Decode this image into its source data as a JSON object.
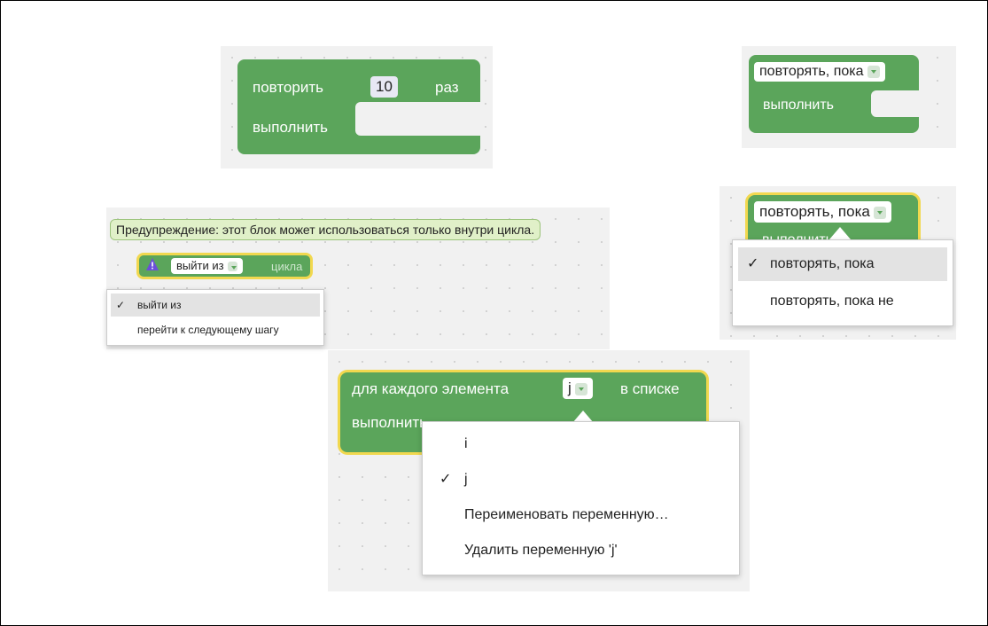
{
  "repeat_block": {
    "label": "повторить",
    "count": "10",
    "suffix": "раз",
    "do": "выполнить"
  },
  "while_block": {
    "mode": "повторять, пока",
    "do": "выполнить"
  },
  "while_dropdown": {
    "field": "повторять, пока",
    "obscured_label": "выполнить",
    "options": [
      "повторять, пока",
      "повторять, пока не"
    ],
    "selected": "повторять, пока",
    "check": "✓"
  },
  "break_block": {
    "warning": "Предупреждение: этот блок может использоваться только внутри цикла.",
    "warning_icon": "warning-triangle-icon",
    "field": "выйти из",
    "suffix": "цикла",
    "options": [
      "выйти из",
      "перейти к следующему шагу"
    ],
    "selected": "выйти из",
    "check": "✓"
  },
  "foreach_block": {
    "label": "для каждого элемента",
    "variable": "j",
    "suffix": "в списке",
    "do": "выполнить",
    "options": [
      "i",
      "j",
      "Переименовать переменную…",
      "Удалить переменную 'j'"
    ],
    "selected": "j",
    "check": "✓"
  },
  "colors": {
    "block": "#5ba55b",
    "highlight": "#f1d84f",
    "workspace": "#f1f1f1"
  }
}
